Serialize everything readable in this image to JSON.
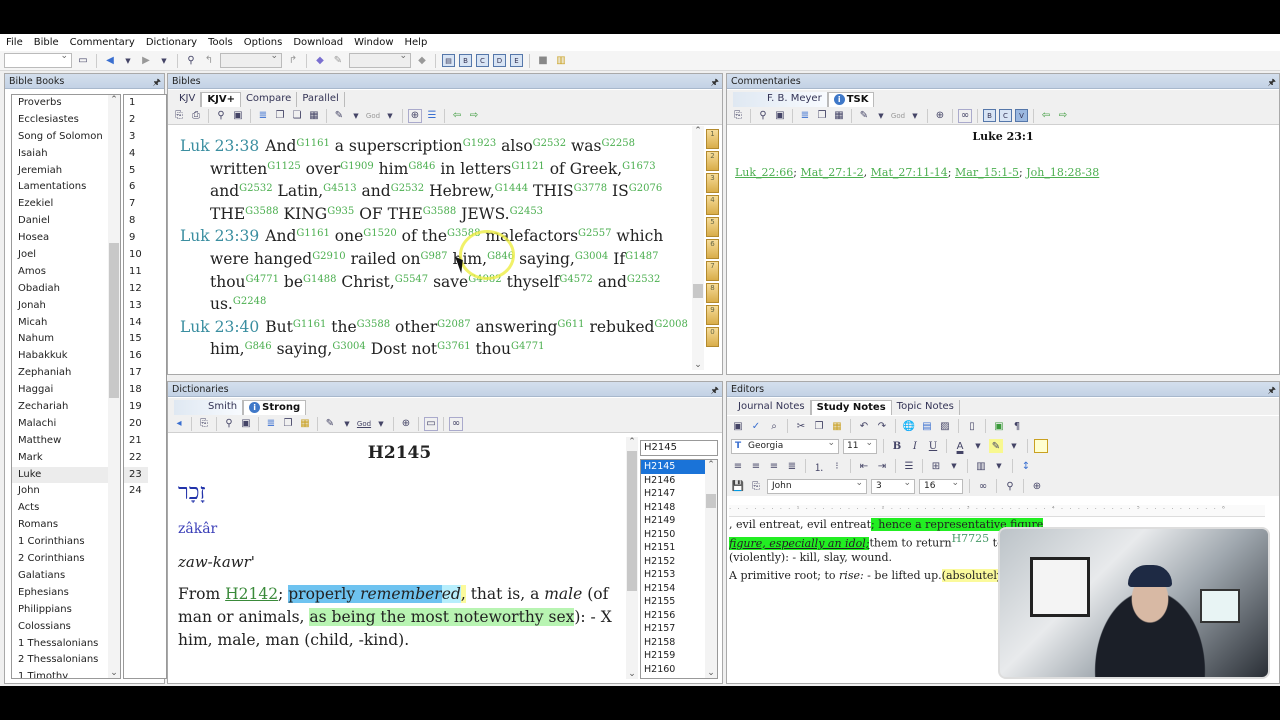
{
  "menu": [
    "File",
    "Bible",
    "Commentary",
    "Dictionary",
    "Tools",
    "Options",
    "Download",
    "Window",
    "Help"
  ],
  "panels": {
    "bible_books": "Bible Books",
    "bibles": "Bibles",
    "commentaries": "Commentaries",
    "dictionaries": "Dictionaries",
    "editors": "Editors"
  },
  "books": [
    "Proverbs",
    "Ecclesiastes",
    "Song of Solomon",
    "Isaiah",
    "Jeremiah",
    "Lamentations",
    "Ezekiel",
    "Daniel",
    "Hosea",
    "Joel",
    "Amos",
    "Obadiah",
    "Jonah",
    "Micah",
    "Nahum",
    "Habakkuk",
    "Zephaniah",
    "Haggai",
    "Zechariah",
    "Malachi",
    "Matthew",
    "Mark",
    "Luke",
    "John",
    "Acts",
    "Romans",
    "1 Corinthians",
    "2 Corinthians",
    "Galatians",
    "Ephesians",
    "Philippians",
    "Colossians",
    "1 Thessalonians",
    "2 Thessalonians",
    "1 Timothy"
  ],
  "selected_book": "Luke",
  "chapters": [
    "1",
    "2",
    "3",
    "4",
    "5",
    "6",
    "7",
    "8",
    "9",
    "10",
    "11",
    "12",
    "13",
    "14",
    "15",
    "16",
    "17",
    "18",
    "19",
    "20",
    "21",
    "22",
    "23",
    "24"
  ],
  "selected_chapter": "23",
  "bible_tabs": [
    "KJV",
    "KJV+",
    "Compare",
    "Parallel"
  ],
  "bible_active_tab": "KJV+",
  "verses": [
    {
      "ref": "Luk 23:38",
      "words": [
        [
          "And",
          "G1161"
        ],
        [
          "a superscription",
          "G1923"
        ],
        [
          "also",
          "G2532"
        ],
        [
          "was",
          "G2258"
        ],
        [
          "written",
          "G1125"
        ],
        [
          "over",
          "G1909"
        ],
        [
          "him",
          "G846"
        ],
        [
          "in letters",
          "G1121"
        ],
        [
          "of Greek,",
          "G1673"
        ],
        [
          "and",
          "G2532"
        ],
        [
          "Latin,",
          "G4513"
        ],
        [
          "and",
          "G2532"
        ],
        [
          "Hebrew,",
          "G1444"
        ],
        [
          "THIS",
          "G3778"
        ],
        [
          "IS",
          "G2076"
        ],
        [
          "THE",
          "G3588"
        ],
        [
          "KING",
          "G935"
        ],
        [
          "OF THE",
          "G3588"
        ],
        [
          "JEWS.",
          "G2453"
        ]
      ]
    },
    {
      "ref": "Luk 23:39",
      "words": [
        [
          "And",
          "G1161"
        ],
        [
          "one",
          "G1520"
        ],
        [
          "of the",
          "G3588"
        ],
        [
          "malefactors",
          "G2557"
        ],
        [
          "which were hanged",
          "G2910"
        ],
        [
          "railed on",
          "G987"
        ],
        [
          "him,",
          "G846"
        ],
        [
          "saying,",
          "G3004"
        ],
        [
          "If",
          "G1487"
        ],
        [
          "thou",
          "G4771"
        ],
        [
          "be",
          "G1488"
        ],
        [
          "Christ,",
          "G5547"
        ],
        [
          "save",
          "G4982"
        ],
        [
          "thyself",
          "G4572"
        ],
        [
          "and",
          "G2532"
        ],
        [
          "us.",
          "G2248"
        ]
      ]
    },
    {
      "ref": "Luk 23:40",
      "words": [
        [
          "But",
          "G1161"
        ],
        [
          "the",
          "G3588"
        ],
        [
          "other",
          "G2087"
        ],
        [
          "answering",
          "G611"
        ],
        [
          "rebuked",
          "G2008"
        ],
        [
          "him,",
          "G846"
        ],
        [
          "saying,",
          "G3004"
        ],
        [
          "Dost not",
          "G3761"
        ],
        [
          "thou",
          "G4771"
        ]
      ]
    }
  ],
  "bookmark_numbers": [
    "1",
    "2",
    "3",
    "4",
    "5",
    "6",
    "7",
    "8",
    "9",
    "0"
  ],
  "commentary_tabs": [
    "F. B. Meyer",
    "TSK"
  ],
  "commentary_active_tab": "TSK",
  "commentary": {
    "heading": "Luke 23:1",
    "links": [
      "Luk_22:66",
      "Mat_27:1-2",
      "Mat_27:11-14",
      "Mar_15:1-5",
      "Joh_18:28-38"
    ],
    "separators": [
      "; ",
      ", ",
      "; ",
      "; ",
      ""
    ]
  },
  "dictionary_tabs": [
    "Smith",
    "Strong"
  ],
  "dictionary_active_tab": "Strong",
  "dictionary": {
    "title": "H2145",
    "hebrew": "זָכָר",
    "transliteration": "zâkâr",
    "pronunciation": "zaw-kawr'",
    "def_from": "From ",
    "def_link": "H2142",
    "def_semicolon": "; ",
    "def_properly": "properly ",
    "def_remembered_a": "remember",
    "def_remembered_b": "ed",
    "def_comma": ",",
    "def_that_is": " that is, a ",
    "def_male": "male",
    "def_line2a": " (of man or animals, ",
    "def_green": "as being the most noteworthy sex",
    "def_rest": "): -    X him, male, man (child, -kind)."
  },
  "strong_search": "H2145",
  "strong_list": [
    "H2145",
    "H2146",
    "H2147",
    "H2148",
    "H2149",
    "H2150",
    "H2151",
    "H2152",
    "H2153",
    "H2154",
    "H2155",
    "H2156",
    "H2157",
    "H2158",
    "H2159",
    "H2160"
  ],
  "strong_selected": "H2145",
  "editor_tabs": [
    "Journal Notes",
    "Study Notes",
    "Topic Notes"
  ],
  "editor_active_tab": "Study Notes",
  "editor": {
    "font": "Georgia",
    "size": "11",
    "book": "John",
    "chapter": "3",
    "verse": "16",
    "ruler": "· · · · · · · · ¹ · · · · · · · · · ² · · · · · · · · · ³ · · · · · · · · · ⁴ · · · · · · · · · ⁵ · · · · · · · · · ⁶",
    "line1_plain": ", evil entreat, evil entreat",
    "line1_green": "; hence a representative figure",
    "line2_green": "figure, especially an idol;",
    "line2_plain": "them to return",
    "line2_ref": "H7725",
    "line2_tail": " to",
    "line3": "(violently): - kill, slay, wound.",
    "line4_plain": "A primitive root; to ",
    "line4_italic": "rise:",
    "line4_rest": " - be lifted up.",
    "line4_yellow": "(absolutely"
  }
}
